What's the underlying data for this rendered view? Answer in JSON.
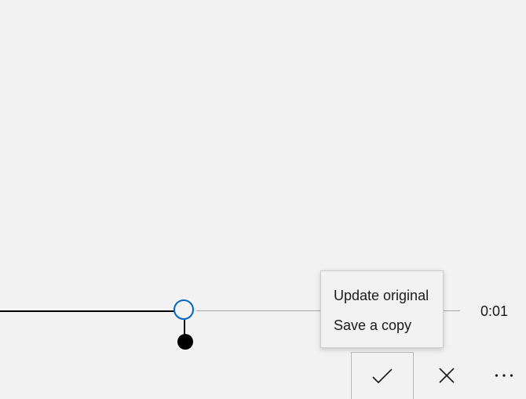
{
  "timeline": {
    "current_time": "0:01"
  },
  "save_menu": {
    "items": [
      {
        "label": "Update original"
      },
      {
        "label": "Save a copy"
      }
    ]
  },
  "command_bar": {
    "buttons": [
      {
        "icon": "checkmark-icon"
      },
      {
        "icon": "close-icon"
      },
      {
        "icon": "more-icon"
      }
    ]
  },
  "colors": {
    "background": "#f2f2f2",
    "accent": "#0067c0",
    "track_played": "#000000",
    "track_remaining": "#a6a6a6"
  }
}
